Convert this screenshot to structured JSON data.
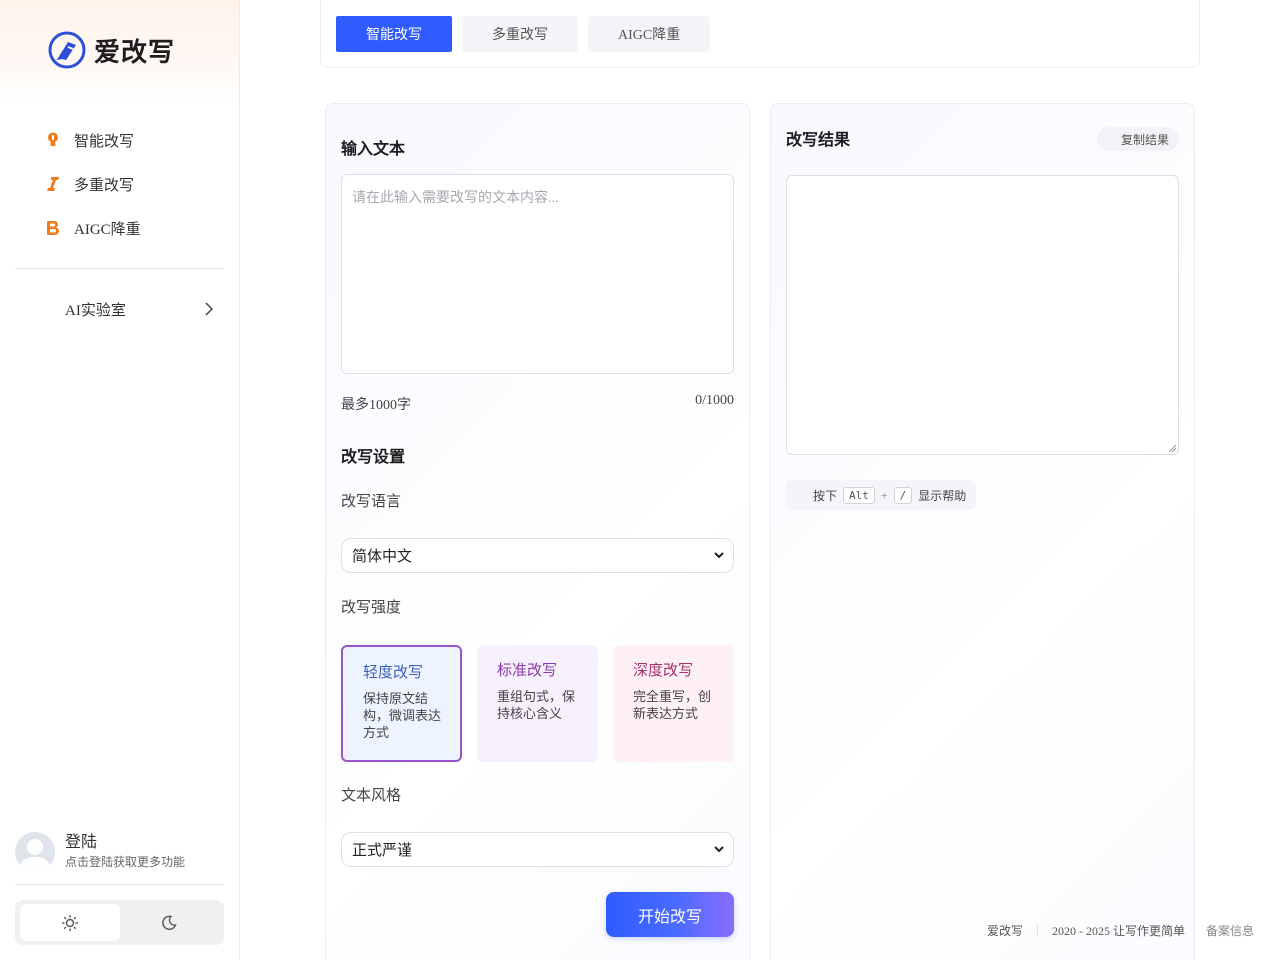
{
  "brand": {
    "name": "爱改写"
  },
  "sidebar": {
    "items": [
      {
        "label": "智能改写",
        "icon": "bulb-icon"
      },
      {
        "label": "多重改写",
        "icon": "italic-icon"
      },
      {
        "label": "AIGC降重",
        "icon": "bold-icon"
      }
    ],
    "lab": {
      "label": "AI实验室"
    }
  },
  "user": {
    "name": "登陆",
    "hint": "点击登陆获取更多功能"
  },
  "tabs": [
    {
      "label": "智能改写",
      "active": true
    },
    {
      "label": "多重改写",
      "active": false
    },
    {
      "label": "AIGC降重",
      "active": false
    }
  ],
  "input": {
    "title": "输入文本",
    "placeholder": "请在此输入需要改写的文本内容...",
    "max_hint": "最多1000字",
    "counter": "0/1000"
  },
  "settings": {
    "title": "改写设置",
    "language_label": "改写语言",
    "language_value": "简体中文",
    "strength_label": "改写强度",
    "cards": [
      {
        "title": "轻度改写",
        "desc": "保持原文结构，微调表达方式",
        "selected": true
      },
      {
        "title": "标准改写",
        "desc": "重组句式，保持核心含义",
        "selected": false
      },
      {
        "title": "深度改写",
        "desc": "完全重写，创新表达方式",
        "selected": false
      }
    ],
    "style_label": "文本风格",
    "style_value": "正式严谨",
    "start_button": "开始改写"
  },
  "result": {
    "title": "改写结果",
    "copy_button": "复制结果",
    "help_prefix": "按下",
    "help_key1": "Alt",
    "help_plus": "+",
    "help_key2": "/",
    "help_suffix": "显示帮助"
  },
  "footer": {
    "brand": "爱改写",
    "copyright": "2020 - 2025 让写作更简单",
    "icp": "备案信息"
  },
  "colors": {
    "primary": "#2f5bff",
    "orange_icon": "#f07c1a",
    "card_border": "#9b55c9"
  }
}
